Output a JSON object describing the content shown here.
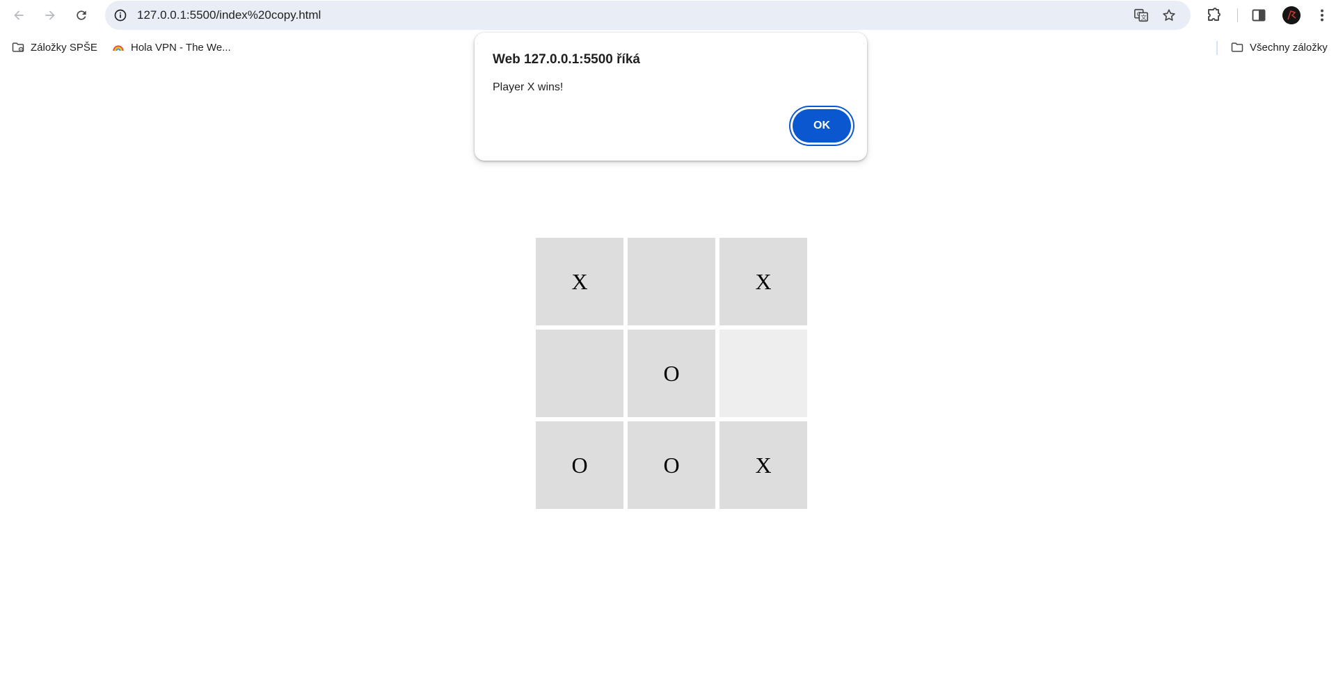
{
  "browser": {
    "url": "127.0.0.1:5500/index%20copy.html",
    "icons": {
      "back": "arrow-left-icon",
      "forward": "arrow-right-icon",
      "reload": "reload-icon",
      "site_info": "info-icon",
      "translate": "translate-icon",
      "bookmark": "star-icon",
      "extensions": "puzzle-icon",
      "side_panel": "side-panel-icon",
      "menu": "kebab-menu-icon"
    },
    "accent_color": "#0b57d0",
    "omnibox_color": "#e9edf6"
  },
  "bookmarks": {
    "items": [
      {
        "label": "Záložky SPŠE",
        "icon": "folder-managed-icon"
      },
      {
        "label": "Hola VPN - The We...",
        "icon": "hola-vpn-icon"
      }
    ],
    "all_bookmarks": {
      "label": "Všechny záložky",
      "icon": "folder-icon"
    }
  },
  "dialog": {
    "title": "Web 127.0.0.1:5500 říká",
    "message": "Player X wins!",
    "ok_label": "OK"
  },
  "board": {
    "cells": [
      {
        "mark": "X"
      },
      {
        "mark": ""
      },
      {
        "mark": "X"
      },
      {
        "mark": ""
      },
      {
        "mark": "O"
      },
      {
        "mark": ""
      },
      {
        "mark": "O"
      },
      {
        "mark": "O"
      },
      {
        "mark": "X"
      }
    ],
    "hovered_cell_index": 5,
    "cell_color": "#dddddd",
    "hover_color": "#eeeeee"
  }
}
